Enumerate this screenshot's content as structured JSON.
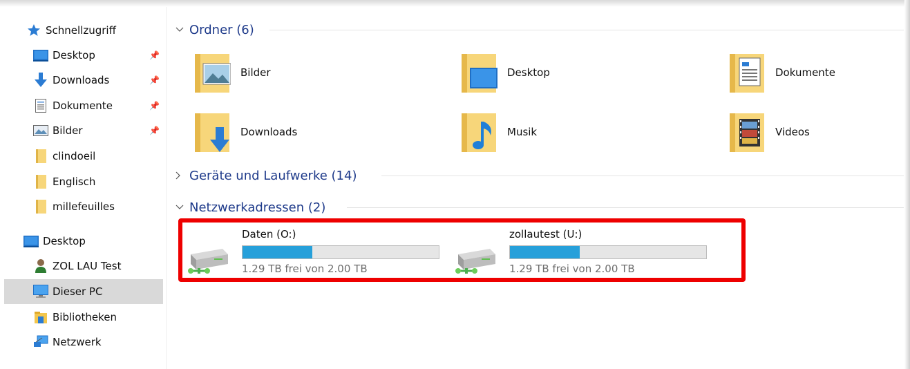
{
  "sidebar": {
    "quick_access": "Schnellzugriff",
    "pinned": [
      {
        "label": "Desktop",
        "icon": "desktop-icon"
      },
      {
        "label": "Downloads",
        "icon": "download-arrow-icon"
      },
      {
        "label": "Dokumente",
        "icon": "document-icon"
      },
      {
        "label": "Bilder",
        "icon": "pictures-icon"
      }
    ],
    "folders": [
      {
        "label": "clindoeil",
        "icon": "folder-icon"
      },
      {
        "label": "Englisch",
        "icon": "folder-icon"
      },
      {
        "label": "millefeuilles",
        "icon": "folder-icon"
      }
    ],
    "tree": [
      {
        "label": "Desktop",
        "icon": "desktop-icon"
      },
      {
        "label": "ZOL LAU Test",
        "icon": "user-icon"
      },
      {
        "label": "Dieser PC",
        "icon": "computer-icon",
        "selected": true
      },
      {
        "label": "Bibliotheken",
        "icon": "library-icon"
      },
      {
        "label": "Netzwerk",
        "icon": "network-icon"
      }
    ]
  },
  "main": {
    "folders_section": {
      "title": "Ordner (6)",
      "expanded": true,
      "items": [
        {
          "label": "Bilder",
          "icon": "pictures-folder-icon"
        },
        {
          "label": "Desktop",
          "icon": "desktop-folder-icon"
        },
        {
          "label": "Dokumente",
          "icon": "documents-folder-icon"
        },
        {
          "label": "Downloads",
          "icon": "downloads-folder-icon"
        },
        {
          "label": "Musik",
          "icon": "music-folder-icon"
        },
        {
          "label": "Videos",
          "icon": "videos-folder-icon"
        }
      ]
    },
    "devices_section": {
      "title": "Geräte und Laufwerke (14)",
      "expanded": false
    },
    "network_section": {
      "title": "Netzwerkadressen (2)",
      "expanded": true,
      "drives": [
        {
          "name": "Daten (O:)",
          "free_text": "1.29 TB frei von 2.00 TB",
          "used_fraction": 0.355,
          "icon": "network-drive-icon"
        },
        {
          "name": "zollautest (U:)",
          "free_text": "1.29 TB frei von 2.00 TB",
          "used_fraction": 0.355,
          "icon": "network-drive-icon"
        }
      ]
    }
  },
  "colors": {
    "section_title": "#1e3a8a",
    "usage_bar": "#26a0da",
    "highlight_border": "#ee0000",
    "selected_bg": "#d9d9d9"
  }
}
